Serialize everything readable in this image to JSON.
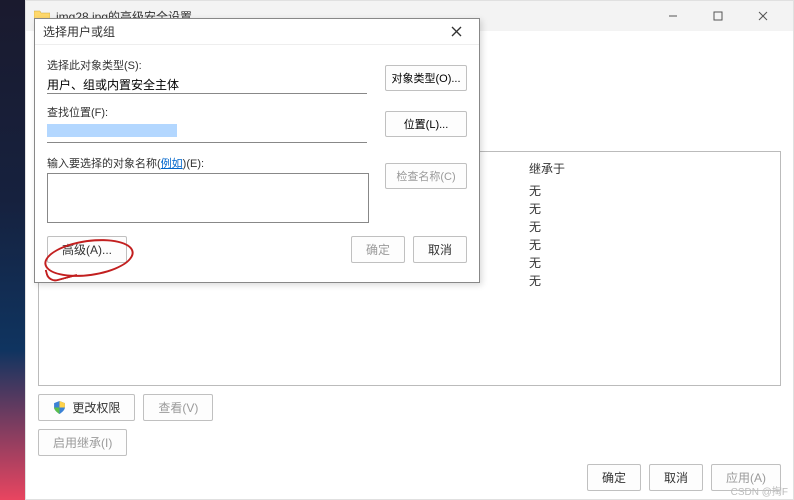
{
  "parent": {
    "title": "img28.jpg的高级安全设置",
    "permHeader": "继承于",
    "permRows": [
      "无",
      "无",
      "无",
      "无",
      "无",
      "无"
    ],
    "changePerm": "更改权限",
    "view": "查看(V)",
    "enableInherit": "启用继承(I)",
    "ok": "确定",
    "cancel": "取消",
    "apply": "应用(A)"
  },
  "dialog": {
    "title": "选择用户或组",
    "selectTypeLabel": "选择此对象类型(S):",
    "selectTypeValue": "用户、组或内置安全主体",
    "objectTypeBtn": "对象类型(O)...",
    "lookLabel": "查找位置(F):",
    "locationBtn": "位置(L)...",
    "enterNameLabel1": "输入要选择的对象名称(",
    "enterNameLink": "例如",
    "enterNameLabel2": ")(E):",
    "checkNameBtn": "检查名称(C)",
    "advancedBtn": "高级(A)...",
    "ok": "确定",
    "cancel": "取消"
  },
  "watermark": "CSDN @掏F"
}
